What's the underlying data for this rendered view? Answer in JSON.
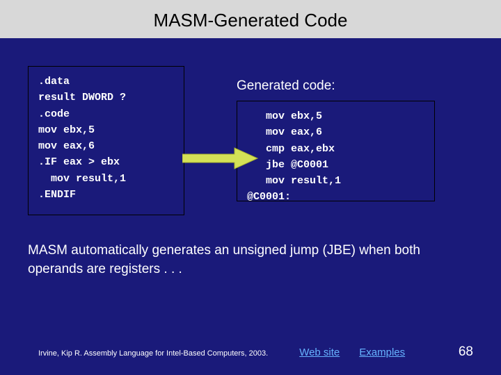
{
  "title": "MASM-Generated Code",
  "leftCode": ".data\nresult DWORD ?\n.code\nmov ebx,5\nmov eax,6\n.IF eax > ebx\n  mov result,1\n.ENDIF",
  "generatedLabel": "Generated code:",
  "rightCode": "   mov ebx,5\n   mov eax,6\n   cmp eax,ebx\n   jbe @C0001\n   mov result,1\n@C0001:",
  "description": "MASM automatically generates an unsigned jump (JBE) when both operands are registers . . .",
  "credit": "Irvine, Kip R. Assembly Language for Intel-Based Computers, 2003.",
  "linkWeb": "Web site",
  "linkExamples": "Examples",
  "pageNumber": "68",
  "colors": {
    "background": "#1a1a7a",
    "titleBg": "#d8d8d8",
    "link": "#66b3ff",
    "arrowFill": "#d4e157",
    "arrowStroke": "#aab42e"
  }
}
